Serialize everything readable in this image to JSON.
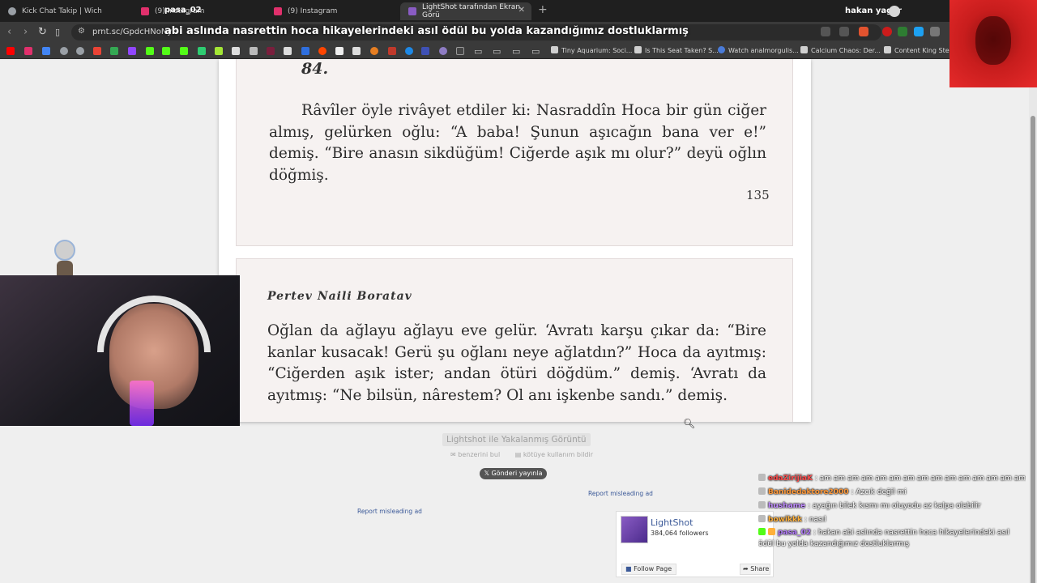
{
  "tabs": [
    {
      "title": "Kick Chat Takip | Wich",
      "icon_color": "#9aa0a6",
      "active": false
    },
    {
      "title": "(9) Instagram",
      "icon_color": "#e1306c",
      "active": false
    },
    {
      "title": "(9) Instagram",
      "icon_color": "#e1306c",
      "active": false
    },
    {
      "title": "LightShot tarafından Ekran Görü",
      "icon_color": "#8a5cc4",
      "active": true
    }
  ],
  "overlay": {
    "username": "pasa_02",
    "message": "abi aslında nasrettin hoca hikayelerindeki asıl ödül bu yolda kazandığımız dostluklarmış"
  },
  "profile": {
    "name": "hakan yagar"
  },
  "address_bar": {
    "url": "prnt.sc/GpdcHNoNyh"
  },
  "bookmarks": [
    {
      "title": "Tiny Aquarium: Soci...",
      "icon_color": "#d0d0d0"
    },
    {
      "title": "Is This Seat Taken? S...",
      "icon_color": "#d0d0d0"
    },
    {
      "title": "Watch analmorgulis...",
      "icon_color": "#4a7bd8"
    },
    {
      "title": "Calcium Chaos: Der...",
      "icon_color": "#d0d0d0"
    },
    {
      "title": "Content King Stean",
      "icon_color": "#d0d0d0"
    }
  ],
  "screenshot": {
    "page1": {
      "tale_number": "84.",
      "paragraph": "Râvîler öyle rivâyet etdiler ki: Nasraddîn Hoca bir gün ciğer almış, gelürken oğlu: “A baba! Şunun aşıcağın bana ver e!” demiş. “Bire anasın sikdüğüm! Ciğerde aşık mı olur?” deyü oğlın döğmiş.",
      "page_number": "135"
    },
    "page2": {
      "author": "Pertev Naili Boratav",
      "paragraph": "Oğlan da ağlayu ağlayu eve gelür. ‘Avratı karşu çıkar da: “Bire kanlar kusacak! Gerü şu oğlanı neye ağlatdın?” Hoca da ayıtmış: “Ciğerden aşık ister; andan ötüri döğdüm.” demiş. ‘Avratı da ayıtmış: “Ne bilsün, nârestem? Ol anı işkenbe sandı.” demiş."
    }
  },
  "lightshot": {
    "caption": "Lightshot ile Yakalanmış Görüntü",
    "find_similar": "benzerini bul",
    "report_abuse": "kötüye kullanım bildir",
    "post_button": "Gönderi yayınla",
    "report_ad_right": "Report misleading ad",
    "report_ad_left": "Report misleading ad"
  },
  "fb_widget": {
    "page_name": "LightShot",
    "followers": "384,064 followers",
    "follow_label": "Follow Page",
    "share_label": "Share"
  },
  "chat": [
    {
      "user": "edaZirijiaK",
      "user_color": "#ff4d4d",
      "text": ": am am am am am am am am am am am am am am am"
    },
    {
      "user": "Banidedaktore2000",
      "user_color": "#ff9a3c",
      "text": ": Azcık değil mi"
    },
    {
      "user": "hushame",
      "user_color": "#c08cff",
      "text": ": ayağın bilek kısmı mı oluyodu az kalpa olabilir"
    },
    {
      "user": "bowikkk",
      "user_color": "#ffb03b",
      "text": ": nasıl"
    },
    {
      "user": "pasa_02",
      "user_color": "#b57cff",
      "text": ": hakan abi aslında nasrettin hoca hikayelerindeki asıl ödül bu yolda kazandığımız dostluklarmış"
    }
  ]
}
